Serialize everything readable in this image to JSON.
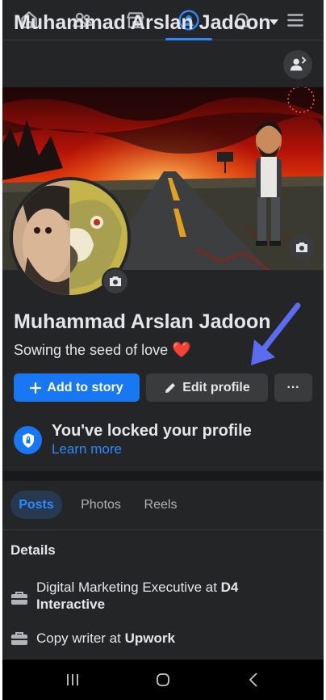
{
  "nav": {
    "items": [
      {
        "name": "home-icon"
      },
      {
        "name": "friends-icon"
      },
      {
        "name": "marketplace-icon"
      },
      {
        "name": "profile-icon",
        "active": true
      },
      {
        "name": "notifications-icon"
      },
      {
        "name": "menu-icon"
      }
    ],
    "active_color": "#2d88ff"
  },
  "header": {
    "name": "Muhammad Arslan Jadoon"
  },
  "profile": {
    "name": "Muhammad Arslan Jadoon",
    "bio": "Sowing the seed of love",
    "bio_emoji": "❤️"
  },
  "actions": {
    "add_story": "Add to story",
    "edit_profile": "Edit profile",
    "more": "···"
  },
  "locked": {
    "title": "You've locked your profile",
    "link": "Learn more"
  },
  "tabs": [
    {
      "label": "Posts",
      "active": true
    },
    {
      "label": "Photos"
    },
    {
      "label": "Reels"
    }
  ],
  "details": {
    "title": "Details",
    "items": [
      {
        "prefix": "Digital Marketing Executive at ",
        "bold": "D4 Interactive"
      },
      {
        "prefix": "Copy writer at ",
        "bold": "Upwork"
      }
    ]
  },
  "colors": {
    "background": "#242526",
    "primary": "#1877f2",
    "text": "#e4e6eb",
    "annotation_arrow": "#5b6cf0"
  }
}
